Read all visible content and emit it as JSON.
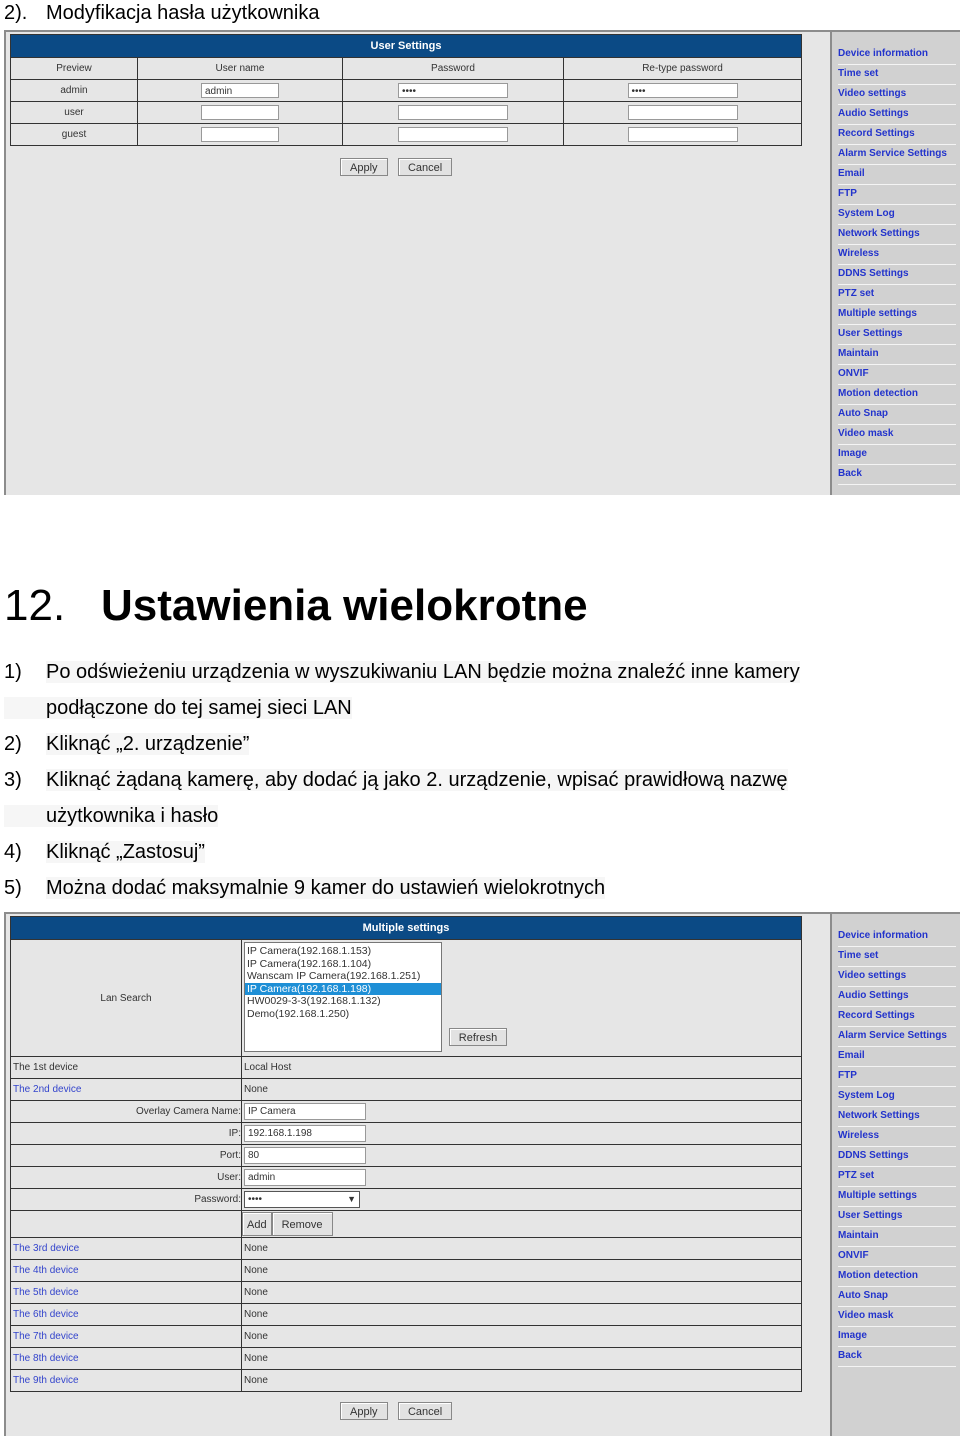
{
  "section_top": {
    "number": "2).",
    "title": "Modyfikacja hasła użytkownika"
  },
  "sidebar_items": [
    "Device information",
    "Time set",
    "Video settings",
    "Audio Settings",
    "Record Settings",
    "Alarm Service Settings",
    "Email",
    "FTP",
    "System Log",
    "Network Settings",
    "Wireless",
    "DDNS Settings",
    "PTZ set",
    "Multiple settings",
    "User Settings",
    "Maintain",
    "ONVIF",
    "Motion detection",
    "Auto Snap",
    "Video mask",
    "Image",
    "Back"
  ],
  "user_settings": {
    "title": "User Settings",
    "columns": [
      "Preview",
      "User name",
      "Password",
      "Re-type password"
    ],
    "rows": [
      {
        "preview": "admin",
        "username": "admin",
        "password": "••••",
        "retype": "••••"
      },
      {
        "preview": "user",
        "username": "",
        "password": "",
        "retype": ""
      },
      {
        "preview": "guest",
        "username": "",
        "password": "",
        "retype": ""
      }
    ],
    "apply_label": "Apply",
    "cancel_label": "Cancel"
  },
  "heading": {
    "number": "12.",
    "title": "Ustawienia wielokrotne"
  },
  "steps": [
    {
      "num": "1)",
      "text": "Po odświeżeniu urządzenia w wyszukiwaniu LAN będzie można znaleźć inne kamery",
      "cont": "podłączone do tej samej sieci LAN"
    },
    {
      "num": "2)",
      "text": "Kliknąć „2. urządzenie”"
    },
    {
      "num": "3)",
      "text": "Kliknąć żądaną kamerę, aby dodać ją jako 2. urządzenie, wpisać prawidłową nazwę",
      "cont": "użytkownika i hasło"
    },
    {
      "num": "4)",
      "text": "Kliknąć „Zastosuj”"
    },
    {
      "num": "5)",
      "text": "Można dodać maksymalnie 9 kamer do ustawień wielokrotnych"
    }
  ],
  "multiple_settings": {
    "title": "Multiple settings",
    "lan_search_label": "Lan Search",
    "lan_list": [
      "IP Camera(192.168.1.153)",
      "IP Camera(192.168.1.104)",
      "Wanscam IP Camera(192.168.1.251)",
      "IP Camera(192.168.1.198)",
      "HW0029-3-3(192.168.1.132)",
      "Demo(192.168.1.250)"
    ],
    "selected_index": 3,
    "refresh_label": "Refresh",
    "device1": {
      "label": "The 1st device",
      "value": "Local Host"
    },
    "device2": {
      "label": "The 2nd device",
      "value": "None"
    },
    "form": {
      "name_label": "Overlay Camera Name:",
      "name_value": "IP Camera",
      "ip_label": "IP:",
      "ip_value": "192.168.1.198",
      "port_label": "Port:",
      "port_value": "80",
      "user_label": "User:",
      "user_value": "admin",
      "password_label": "Password:",
      "password_value": "••••",
      "add_label": "Add",
      "remove_label": "Remove"
    },
    "other_devices": [
      {
        "label": "The 3rd device",
        "value": "None"
      },
      {
        "label": "The 4th device",
        "value": "None"
      },
      {
        "label": "The 5th device",
        "value": "None"
      },
      {
        "label": "The 6th device",
        "value": "None"
      },
      {
        "label": "The 7th device",
        "value": "None"
      },
      {
        "label": "The 8th device",
        "value": "None"
      },
      {
        "label": "The 9th device",
        "value": "None"
      }
    ],
    "apply_label": "Apply",
    "cancel_label": "Cancel"
  }
}
